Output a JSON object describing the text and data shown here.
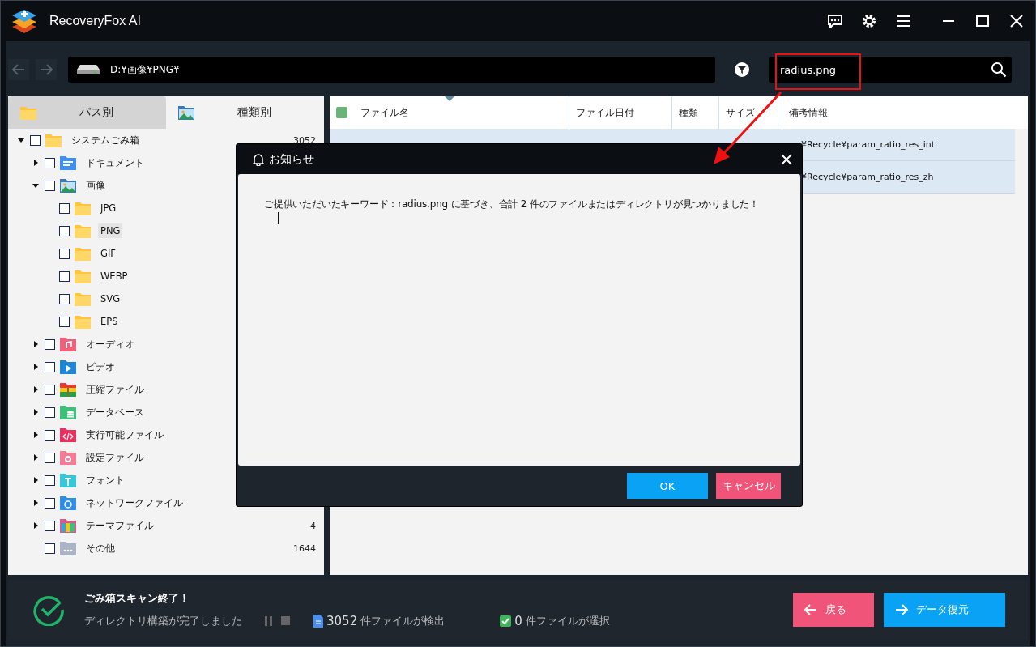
{
  "window": {
    "title": "RecoveryFox AI"
  },
  "toolbar": {
    "path": "D:¥画像¥PNG¥",
    "search": {
      "value": "radius.png"
    }
  },
  "tabs": [
    {
      "label": "パス別",
      "selected": false,
      "kind": "folder"
    },
    {
      "label": "種類別",
      "selected": true,
      "kind": "image"
    }
  ],
  "tree": [
    {
      "label": "システムごみ箱",
      "kind": "folder",
      "count": "3052",
      "checked": false,
      "expanded": true,
      "selected": false,
      "children": [
        {
          "label": "ドキュメント",
          "kind": "document",
          "checked": false,
          "expanded": false,
          "selected": false
        },
        {
          "label": "画像",
          "kind": "image",
          "checked": false,
          "expanded": true,
          "selected": false,
          "children": [
            {
              "label": "JPG",
              "kind": "folder",
              "checked": false,
              "selected": false
            },
            {
              "label": "PNG",
              "kind": "folder",
              "checked": false,
              "selected": true
            },
            {
              "label": "GIF",
              "kind": "folder",
              "checked": false,
              "selected": false
            },
            {
              "label": "WEBP",
              "kind": "folder",
              "checked": false,
              "selected": false
            },
            {
              "label": "SVG",
              "kind": "folder",
              "checked": false,
              "selected": false
            },
            {
              "label": "EPS",
              "kind": "folder",
              "checked": false,
              "selected": false
            }
          ]
        },
        {
          "label": "オーディオ",
          "kind": "audio",
          "checked": false,
          "expanded": false,
          "selected": false
        },
        {
          "label": "ビデオ",
          "kind": "video",
          "checked": false,
          "expanded": false,
          "selected": false
        },
        {
          "label": "圧縮ファイル",
          "kind": "archive",
          "checked": false,
          "expanded": false,
          "selected": false
        },
        {
          "label": "データベース",
          "kind": "database",
          "checked": false,
          "expanded": false,
          "selected": false
        },
        {
          "label": "実行可能ファイル",
          "kind": "executable",
          "checked": false,
          "expanded": false,
          "selected": false
        },
        {
          "label": "設定ファイル",
          "kind": "settings",
          "checked": false,
          "expanded": false,
          "selected": false
        },
        {
          "label": "フォント",
          "kind": "font",
          "checked": false,
          "expanded": false,
          "selected": false
        },
        {
          "label": "ネットワークファイル",
          "kind": "network",
          "checked": false,
          "expanded": false,
          "selected": false
        },
        {
          "label": "テーマファイル",
          "kind": "theme",
          "count": "4",
          "checked": false,
          "expanded": false,
          "selected": false
        },
        {
          "label": "その他",
          "kind": "other",
          "count": "1644",
          "checked": false,
          "selected": false
        }
      ]
    }
  ],
  "table": {
    "columns": [
      "ファイル名",
      "ファイル日付",
      "種類",
      "サイズ",
      "備考情報"
    ],
    "rows": [
      {
        "remark": "¥Recycle¥param_ratio_res_intl",
        "selected": true
      },
      {
        "remark": "¥Recycle¥param_ratio_res_zh",
        "selected": true
      }
    ]
  },
  "dialog": {
    "title": "お知らせ",
    "message": "ご提供いただいたキーワード：radius.png に基づき、合計 2 件のファイルまたはディレクトリが見つかりました！",
    "buttons": [
      {
        "label": "OK",
        "kind": "primary"
      },
      {
        "label": "キャンセル",
        "kind": "cancel"
      }
    ]
  },
  "status": {
    "title": "ごみ箱スキャン終了！",
    "subtitle": "ディレクトリ構築が完了しました",
    "found_count": "3052",
    "found_label": "件ファイルが検出",
    "selected_count": "0",
    "selected_label": "件ファイルが選択",
    "selected_checked": true,
    "buttons": [
      {
        "label": "戻る",
        "kind": "back"
      },
      {
        "label": "データ復元",
        "kind": "recover"
      }
    ]
  }
}
